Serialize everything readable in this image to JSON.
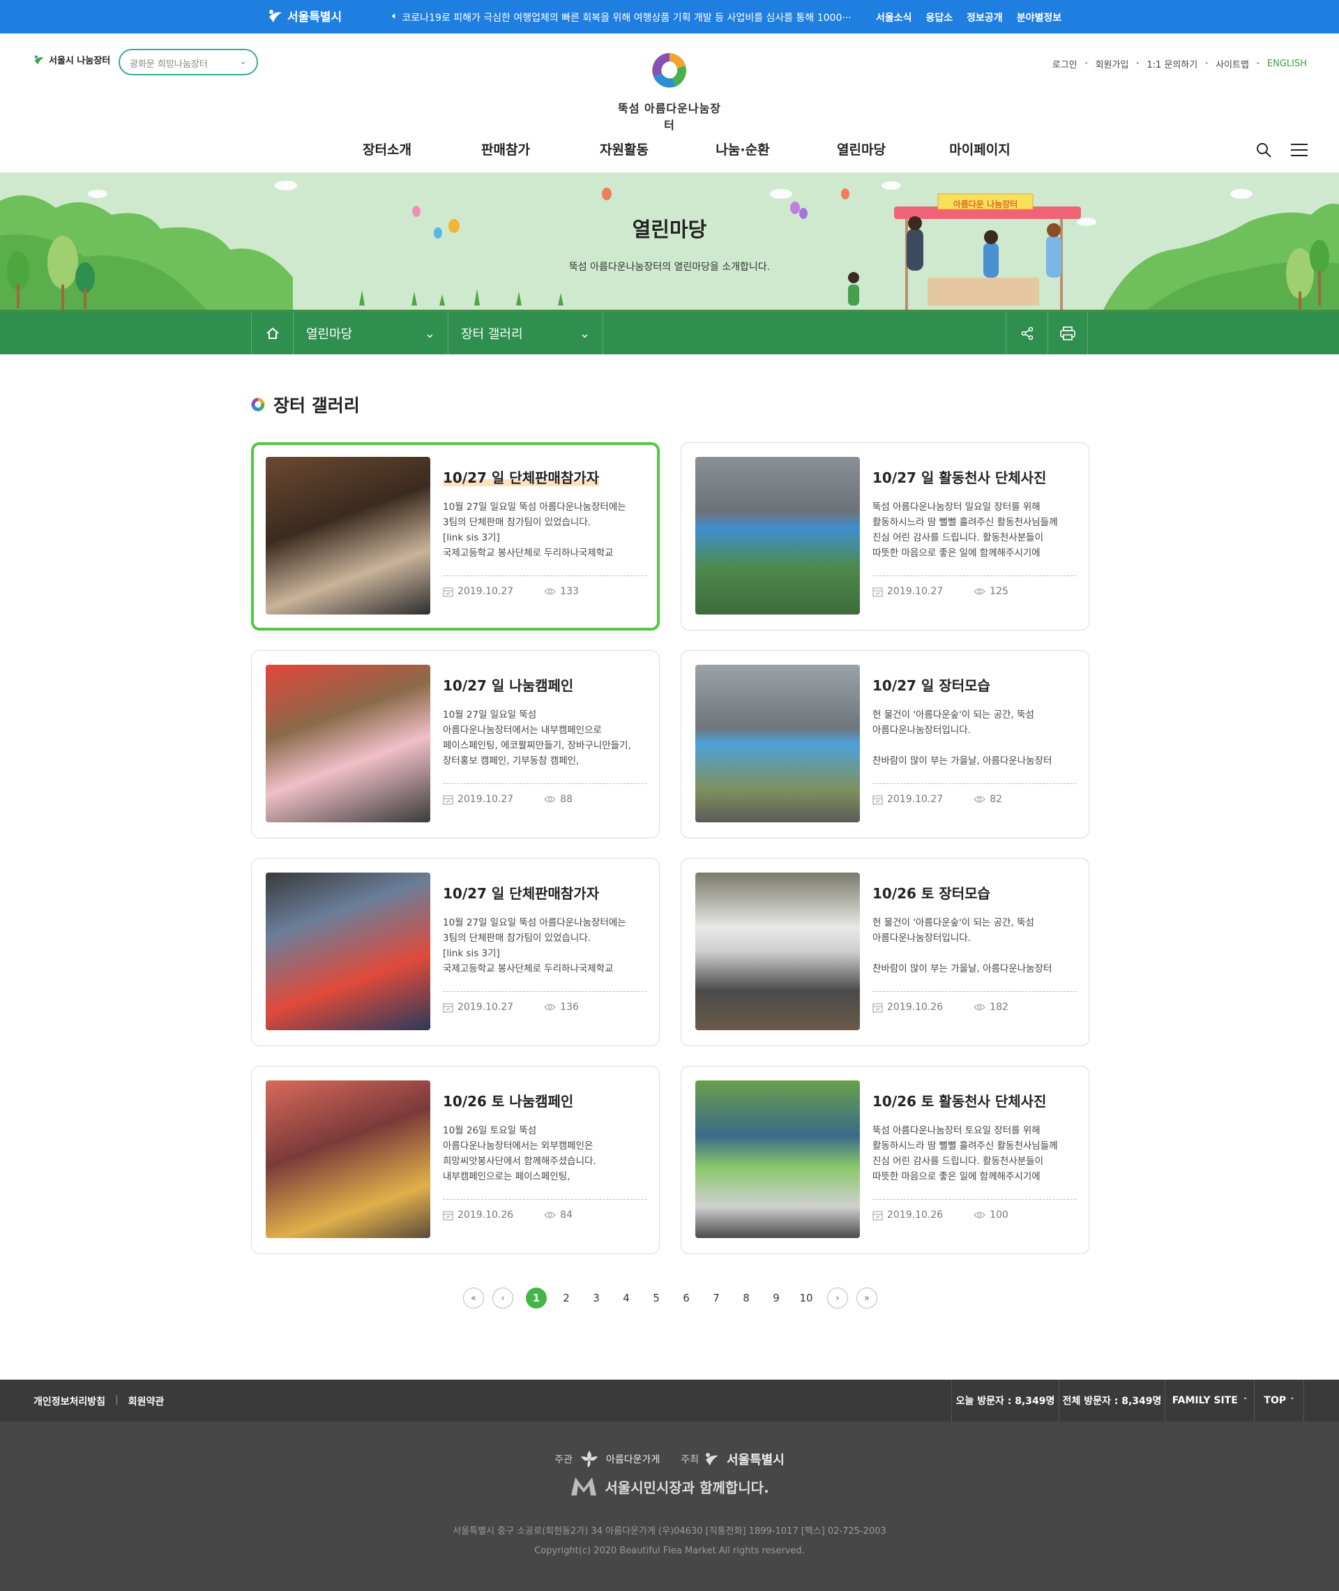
{
  "topbar": {
    "city_name": "서울특별시",
    "notice": "코로나19로 피해가 극심한 여행업체의 빠른 회복을 위해 여행상품 기획 개발 등 사업비를 심사를 통해 1000···",
    "links": [
      "서울소식",
      "응답소",
      "정보공개",
      "분야별정보"
    ]
  },
  "header": {
    "brand_small": "서울시 나눔장터",
    "market_select": "광화문 희망나눔장터",
    "logo_name": "뚝섬 아름다운나눔장터",
    "util_links": [
      "로그인",
      "회원가입",
      "1:1 문의하기",
      "사이트맵"
    ],
    "english": "ENGLISH",
    "gnb": [
      "장터소개",
      "판매참가",
      "자원활동",
      "나눔·순환",
      "열린마당",
      "마이페이지"
    ]
  },
  "hero": {
    "title": "열린마당",
    "subtitle": "뚝섬 아름다운나눔장터의 열린마당을 소개합니다.",
    "booth_sign": "아름다운 나눔장터"
  },
  "locbar": {
    "depth1": "열린마당",
    "depth2": "장터 갤러리"
  },
  "section_title": "장터 갤러리",
  "cards": [
    {
      "title": "10/27 일 단체판매참가자",
      "desc": "10월 27일 일요일 뚝섬 아름다운나눔장터에는\n3팀의 단체판매 참가팀이 있었습니다.\n[link sis 3기]\n국제고등학교 봉사단체로 두리하나국제학교",
      "date": "2019.10.27",
      "views": "133"
    },
    {
      "title": "10/27 일 활동천사 단체사진",
      "desc": "뚝섬 아름다운나눔장터 일요일 장터를 위해\n활동하시느라 땀 뻘뻘 흘려주신 활동천사님들께\n진심 어린 감사를 드립니다. 활동천사분들이\n따뜻한 마음으로 좋은 일에 함께해주시기에",
      "date": "2019.10.27",
      "views": "125"
    },
    {
      "title": "10/27 일 나눔캠페인",
      "desc": "10월 27일 일요일 뚝섬\n아름다운나눔장터에서는 내부캠페인으로\n페이스페인팅, 에코팔찌만들기, 장바구니만들기,\n장터홍보 캠페인, 기부동참 캠페인,",
      "date": "2019.10.27",
      "views": "88"
    },
    {
      "title": "10/27 일 장터모습",
      "desc": "헌 물건이 '아름다운숲'이 되는 공간, 뚝섬\n아름다운나눔장터입니다.\n\n찬바람이 많이 부는 가을날, 아름다운나눔장터",
      "date": "2019.10.27",
      "views": "82"
    },
    {
      "title": "10/27 일 단체판매참가자",
      "desc": "10월 27일 일요일 뚝섬 아름다운나눔장터에는\n3팀의 단체판매 참가팀이 있었습니다.\n[link sis 3기]\n국제고등학교 봉사단체로 두리하나국제학교",
      "date": "2019.10.27",
      "views": "136"
    },
    {
      "title": "10/26 토 장터모습",
      "desc": "헌 물건이 '아름다운숲'이 되는 공간, 뚝섬\n아름다운나눔장터입니다.\n\n찬바람이 많이 부는 가을날, 아름다운나눔장터",
      "date": "2019.10.26",
      "views": "182"
    },
    {
      "title": "10/26 토 나눔캠페인",
      "desc": "10월 26일 토요일 뚝섬\n아름다운나눔장터에서는 외부캠페인은\n희망씨앗봉사단에서 함께해주셨습니다.\n내부캠페인으로는 페이스페인팅,",
      "date": "2019.10.26",
      "views": "84"
    },
    {
      "title": "10/26 토 활동천사 단체사진",
      "desc": "뚝섬 아름다운나눔장터 토요일 장터를 위해\n활동하시느라 땀 뻘뻘 흘려주신 활동천사님들께\n진심 어린 감사를 드립니다. 활동천사분들이\n따뜻한 마음으로 좋은 일에 함께해주시기에",
      "date": "2019.10.26",
      "views": "100"
    }
  ],
  "pagination": {
    "pages": [
      "1",
      "2",
      "3",
      "4",
      "5",
      "6",
      "7",
      "8",
      "9",
      "10"
    ],
    "current": "1"
  },
  "footbar": {
    "privacy": "개인정보처리방침",
    "terms": "회원약관",
    "today_visitors": "오늘 방문자 : 8,349명",
    "total_visitors": "전체 방문자 : 8,349명",
    "family_site": "FAMILY SITE",
    "top": "TOP"
  },
  "footer": {
    "host_label": "주관",
    "host_name": "아름다운가게",
    "organizer_label": "주최",
    "organizer_name": "서울특별시",
    "campaign": "서울시민시장과 함께합니다.",
    "address": "서울특별시 중구 소공로(회현동2가) 34 아름다운가게 (우)04630 [직통전화] 1899-1017 [팩스] 02-725-2003",
    "copyright": "Copyright(c) 2020 Beautiful Flea Market All rights reserved."
  },
  "colors": {
    "topbar": "#1f7fe0",
    "accent_green": "#2f8f4f",
    "active_border": "#5bc24b",
    "hero_bg": "#cfe9cf"
  }
}
